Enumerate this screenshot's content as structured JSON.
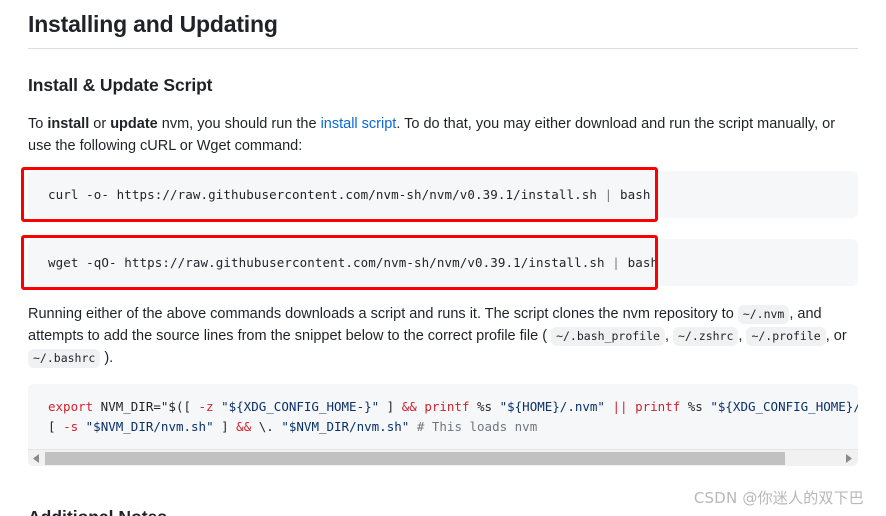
{
  "page": {
    "title": "Installing and Updating",
    "section_heading": "Install & Update Script",
    "bottom_heading_clipped": "Additional Notes"
  },
  "intro": {
    "t1": "To ",
    "b1": "install",
    "t2": " or ",
    "b2": "update",
    "t3": " nvm, you should run the ",
    "link": "install script",
    "t4": ". To do that, you may either download and run the script manually, or use the following cURL or Wget command:"
  },
  "commands": [
    {
      "name": "curl-command",
      "prefix": "curl -o- https://raw.githubusercontent.com/nvm-sh/nvm/v0.39.1/install.sh ",
      "pipe": "|",
      "suffix": " bash",
      "annotated": true
    },
    {
      "name": "wget-command",
      "prefix": "wget -qO- https://raw.githubusercontent.com/nvm-sh/nvm/v0.39.1/install.sh ",
      "pipe": "|",
      "suffix": " bash",
      "annotated": true
    }
  ],
  "explain": {
    "t1": "Running either of the above commands downloads a script and runs it. The script clones the nvm repository to ",
    "chip1": "~/.nvm",
    "t2": ", and attempts to add the source lines from the snippet below to the correct profile file ( ",
    "chip2": "~/.bash_profile",
    "t3": ", ",
    "chip3": "~/.zshrc",
    "t4": ", ",
    "chip4": "~/.profile",
    "t5": ", or ",
    "chip5": "~/.bashrc",
    "t6": " )."
  },
  "snippet": {
    "line1": [
      {
        "cls": "k",
        "text": "export"
      },
      {
        "cls": "p",
        "text": " NVM_DIR=\"$([ "
      },
      {
        "cls": "k",
        "text": "-z"
      },
      {
        "cls": "p",
        "text": " "
      },
      {
        "cls": "s",
        "text": "\"${XDG_CONFIG_HOME-}\""
      },
      {
        "cls": "p",
        "text": " ] "
      },
      {
        "cls": "k",
        "text": "&&"
      },
      {
        "cls": "p",
        "text": " "
      },
      {
        "cls": "k",
        "text": "printf"
      },
      {
        "cls": "p",
        "text": " %s "
      },
      {
        "cls": "s",
        "text": "\"${HOME}/.nvm\""
      },
      {
        "cls": "p",
        "text": " "
      },
      {
        "cls": "k",
        "text": "||"
      },
      {
        "cls": "p",
        "text": " "
      },
      {
        "cls": "k",
        "text": "printf"
      },
      {
        "cls": "p",
        "text": " %s "
      },
      {
        "cls": "s",
        "text": "\"${XDG_CONFIG_HOME}/n"
      }
    ],
    "line2": [
      {
        "cls": "p",
        "text": "[ "
      },
      {
        "cls": "k",
        "text": "-s"
      },
      {
        "cls": "p",
        "text": " "
      },
      {
        "cls": "s",
        "text": "\"$NVM_DIR/nvm.sh\""
      },
      {
        "cls": "p",
        "text": " ] "
      },
      {
        "cls": "k",
        "text": "&&"
      },
      {
        "cls": "p",
        "text": " \\. "
      },
      {
        "cls": "s",
        "text": "\"$NVM_DIR/nvm.sh\""
      },
      {
        "cls": "p",
        "text": " "
      },
      {
        "cls": "c",
        "text": "# This loads nvm"
      }
    ]
  },
  "scrollbar": {
    "left_arrow": "scroll-left-arrow-icon",
    "right_arrow": "scroll-right-arrow-icon",
    "thumb_percent": 93
  },
  "watermark": "CSDN @你迷人的双下巴",
  "colors": {
    "annotation_red": "#fb0000",
    "link_blue": "#0969da",
    "code_bg": "#f6f7f9",
    "keyword_red": "#cf222e",
    "string_blue": "#0a3069",
    "comment_gray": "#6e7781"
  }
}
